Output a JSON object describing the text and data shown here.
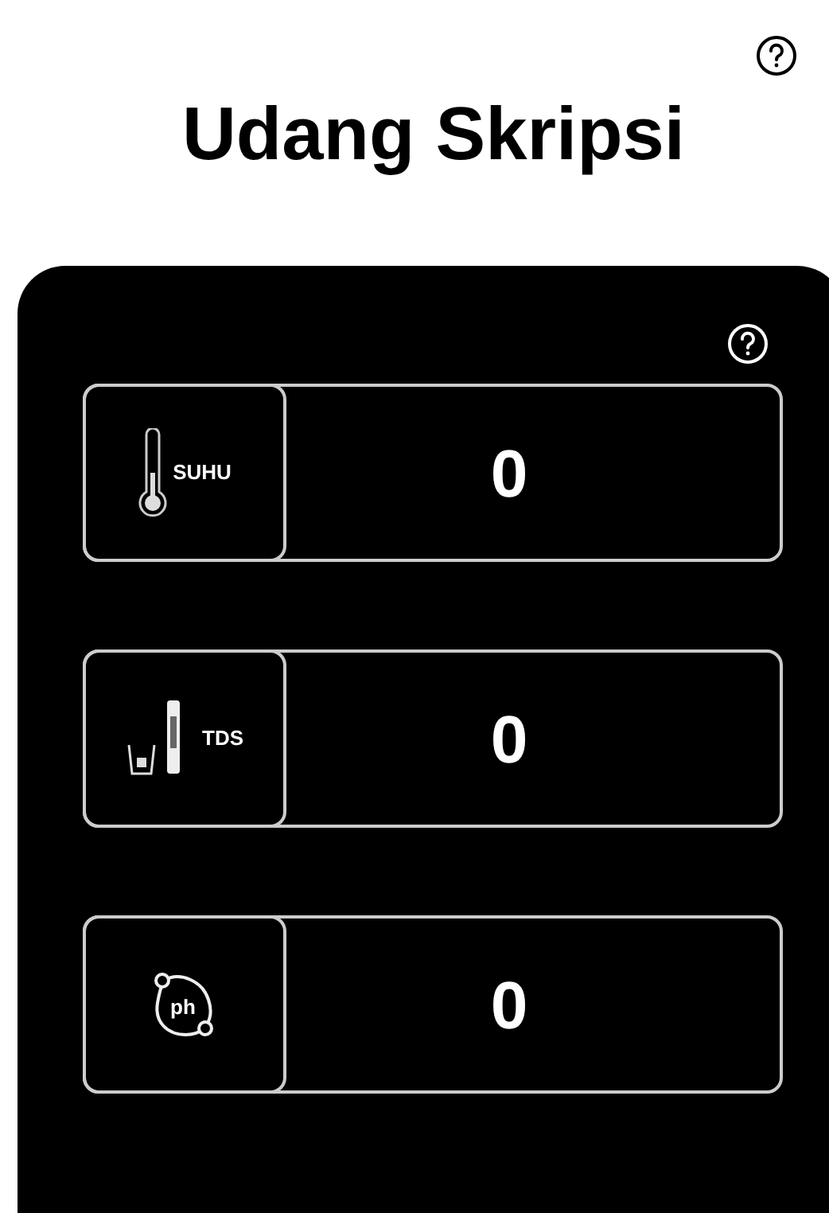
{
  "title": "Udang Skripsi",
  "sensors": [
    {
      "kind": "thermometer",
      "label": "SUHU",
      "value": "0"
    },
    {
      "kind": "tds",
      "label": "TDS",
      "value": "0"
    },
    {
      "kind": "ph",
      "icon_text": "ph",
      "value": "0"
    }
  ]
}
